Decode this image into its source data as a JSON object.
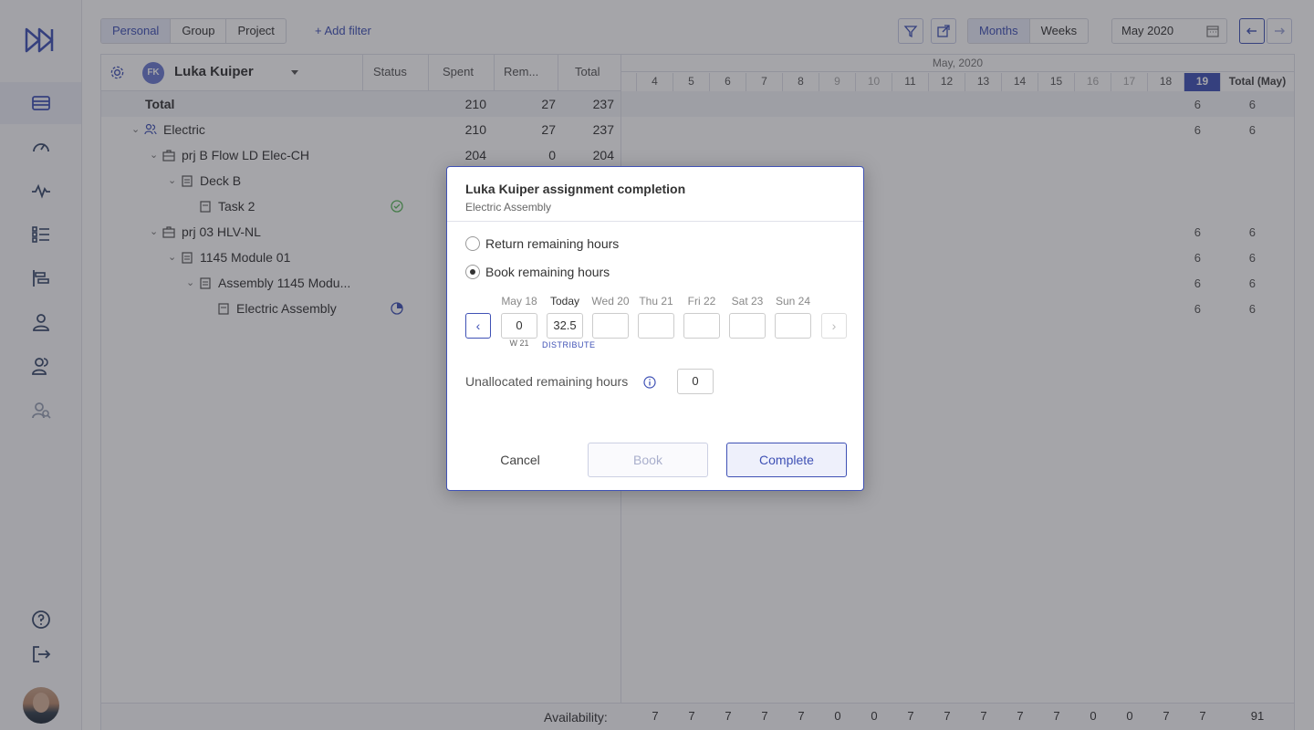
{
  "filters": {
    "tabs": [
      {
        "label": "Personal",
        "active": true
      },
      {
        "label": "Group",
        "active": false
      },
      {
        "label": "Project",
        "active": false
      }
    ],
    "add_filter": "+ Add filter"
  },
  "view": {
    "months": "Months",
    "weeks": "Weeks",
    "period": "May 2020"
  },
  "grid": {
    "person_initials": "FK",
    "person_name": "Luka Kuiper",
    "columns": {
      "status": "Status",
      "spent": "Spent",
      "remaining": "Rem...",
      "total": "Total"
    },
    "month": "May, 2020",
    "days": [
      "4",
      "5",
      "6",
      "7",
      "8",
      "9",
      "10",
      "11",
      "12",
      "13",
      "14",
      "15",
      "16",
      "17",
      "18",
      "19"
    ],
    "total_month_label": "Total (May)",
    "rows": [
      {
        "name": "Total",
        "spent": "210",
        "remaining": "27",
        "total": "237",
        "day19": "6",
        "month_total": "6"
      },
      {
        "name": "Electric",
        "spent": "210",
        "remaining": "27",
        "total": "237",
        "day19": "6",
        "month_total": "6"
      },
      {
        "name": "prj B Flow LD Elec-CH",
        "spent": "204",
        "remaining": "0",
        "total": "204"
      },
      {
        "name": "Deck B"
      },
      {
        "name": "Task 2"
      },
      {
        "name": "prj 03 HLV-NL",
        "day19": "6",
        "month_total": "6"
      },
      {
        "name": "1145 Module 01",
        "day19": "6",
        "month_total": "6"
      },
      {
        "name": "Assembly 1145 Modu...",
        "day19": "6",
        "month_total": "6"
      },
      {
        "name": "Electric Assembly",
        "day19": "6",
        "month_total": "6"
      }
    ],
    "availability_label": "Availability:",
    "availability": [
      "7",
      "7",
      "7",
      "7",
      "7",
      "0",
      "0",
      "7",
      "7",
      "7",
      "7",
      "7",
      "0",
      "0",
      "7",
      "7"
    ],
    "availability_total": "91"
  },
  "modal": {
    "title": "Luka Kuiper assignment completion",
    "subtitle": "Electric Assembly",
    "option_return": "Return remaining hours",
    "option_book": "Book remaining hours",
    "selected_option": "book",
    "days": [
      {
        "label": "May 18",
        "value": "0"
      },
      {
        "label": "Today",
        "value": "32.5"
      },
      {
        "label": "Wed 20",
        "value": ""
      },
      {
        "label": "Thu 21",
        "value": ""
      },
      {
        "label": "Fri 22",
        "value": ""
      },
      {
        "label": "Sat 23",
        "value": ""
      },
      {
        "label": "Sun 24",
        "value": ""
      }
    ],
    "week_label": "W 21",
    "distribute": "DISTRIBUTE",
    "unallocated_label": "Unallocated remaining hours",
    "unallocated_value": "0",
    "cancel": "Cancel",
    "book": "Book",
    "complete": "Complete"
  },
  "colors": {
    "accent": "#3f51b5",
    "overlay": "rgba(40,40,50,0.42)"
  }
}
